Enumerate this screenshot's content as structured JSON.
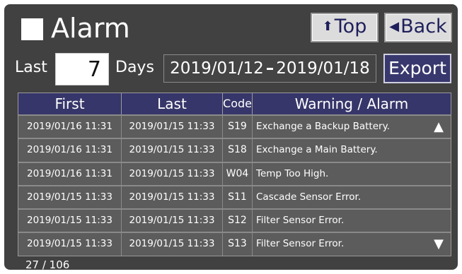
{
  "header": {
    "title": "Alarm",
    "top_button": "Top",
    "back_button": "Back"
  },
  "filter": {
    "last_label": "Last",
    "days_value": "7",
    "days_label": "Days",
    "range_start": "2019/01/12",
    "range_sep": "–",
    "range_end": "2019/01/18",
    "export_button": "Export"
  },
  "table": {
    "columns": [
      "First",
      "Last",
      "Code",
      "Warning / Alarm"
    ],
    "rows": [
      {
        "first": "2019/01/16 11:31",
        "last": "2019/01/15 11:33",
        "code": "S19",
        "message": "Exchange a Backup Battery."
      },
      {
        "first": "2019/01/16 11:31",
        "last": "2019/01/15 11:33",
        "code": "S18",
        "message": "Exchange a Main Battery."
      },
      {
        "first": "2019/01/16 11:31",
        "last": "2019/01/15 11:33",
        "code": "W04",
        "message": "Temp Too High."
      },
      {
        "first": "2019/01/15 11:33",
        "last": "2019/01/15 11:33",
        "code": "S11",
        "message": "Cascade Sensor Error."
      },
      {
        "first": "2019/01/15 11:33",
        "last": "2019/01/15 11:33",
        "code": "S12",
        "message": "Filter Sensor Error."
      },
      {
        "first": "2019/01/15 11:33",
        "last": "2019/01/15 11:33",
        "code": "S13",
        "message": "Filter Sensor Error."
      }
    ]
  },
  "footer": {
    "count": "27 / 106"
  },
  "icons": {
    "title_marker": "square-icon",
    "top": "arrow-up-icon",
    "back": "triangle-left-icon",
    "scroll_up": "scroll-up-icon",
    "scroll_down": "scroll-down-icon"
  },
  "colors": {
    "background": "#414141",
    "header_row": "#36366a",
    "row": "#5c5c5c",
    "export_button": "#38386e"
  }
}
